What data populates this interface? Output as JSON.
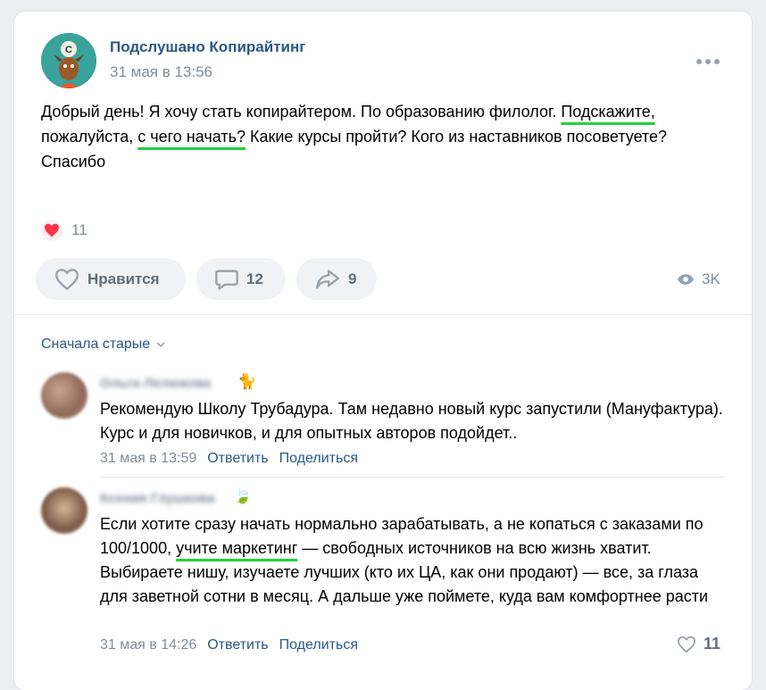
{
  "post": {
    "group_name": "Подслушано Копирайтинг",
    "date": "31 мая в 13:56",
    "text_parts": {
      "p1": "Добрый день! Я хочу стать копирайтером. По образованию филолог. ",
      "p2": "Подскажите,",
      "p3": " пожалуйста, ",
      "p4": "с чего начать?",
      "p5": " Какие курсы пройти? Кого из наставников посоветуете?",
      "p6": "Спасибо"
    },
    "reactions_count": "11",
    "actions": {
      "like_label": "Нравится",
      "comments_count": "12",
      "shares_count": "9",
      "views": "3K"
    }
  },
  "comments_sort": "Сначала старые",
  "comments": [
    {
      "author": "Ольга Лелюкова",
      "emoji": "🐈",
      "text": "Рекомендую Школу Трубадура. Там недавно новый курс запустили (Мануфактура). Курс и для новичков, и для опытных авторов подойдет..",
      "date": "31 мая в 13:59",
      "reply": "Ответить",
      "share": "Поделиться"
    },
    {
      "author": "Ксения Глушкова",
      "emoji": "🍃",
      "text_a": "Если хотите сразу начать нормально зарабатывать, а не копаться с заказами по 100/1000, ",
      "text_b": "учите маркетинг",
      "text_c": " — свободных источников на всю жизнь хватит. Выбираете нишу, изучаете лучших (кто их ЦА, как они продают) — все, за глаза для заветной сотни в месяц. А дальше уже поймете, куда вам комфортнее расти",
      "date": "31 мая в 14:26",
      "reply": "Ответить",
      "share": "Поделиться",
      "likes": "11"
    }
  ],
  "colors": {
    "accent_link": "#2a5885",
    "muted": "#818c99",
    "highlight_underline": "#22d33a",
    "heart": "#ff3347"
  }
}
